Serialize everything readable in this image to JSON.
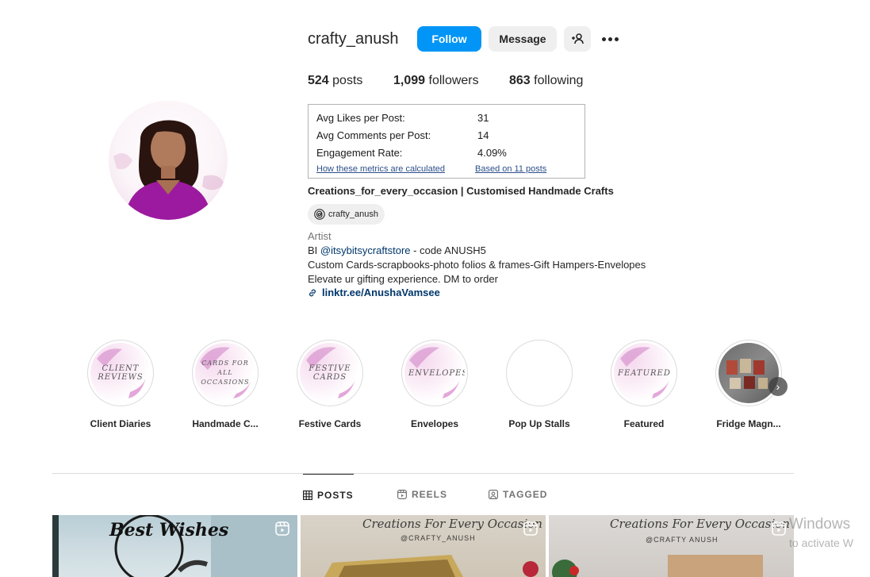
{
  "profile": {
    "username": "crafty_anush",
    "follow_label": "Follow",
    "message_label": "Message",
    "stats": {
      "posts_count": "524",
      "posts_label": "posts",
      "followers_count": "1,099",
      "followers_label": "followers",
      "following_count": "863",
      "following_label": "following"
    }
  },
  "metrics": {
    "avg_likes_label": "Avg Likes per Post:",
    "avg_likes_value": "31",
    "avg_comments_label": "Avg Comments per Post:",
    "avg_comments_value": "14",
    "engagement_label": "Engagement Rate:",
    "engagement_value": "4.09%",
    "how_link": "How these metrics are calculated",
    "based_link": "Based on 11 posts"
  },
  "bio": {
    "full_name": "Creations_for_every_occasion | Customised Handmade Crafts",
    "threads_handle": "crafty_anush",
    "category": "Artist",
    "line1_prefix": "BI ",
    "line1_mention": "@itsybitsycraftstore",
    "line1_suffix": " - code ANUSH5",
    "line2": "Custom Cards-scrapbooks-photo folios & frames-Gift Hampers-Envelopes",
    "line3": "Elevate ur gifting experience. DM to order",
    "link": "linktr.ee/AnushaVamsee"
  },
  "highlights": [
    {
      "label": "Client Diaries",
      "cover_text": "Client Reviews"
    },
    {
      "label": "Handmade C...",
      "cover_text": "Cards for all occasions"
    },
    {
      "label": "Festive Cards",
      "cover_text": "Festive Cards"
    },
    {
      "label": "Envelopes",
      "cover_text": "Envelopes"
    },
    {
      "label": "Pop Up Stalls",
      "cover_text": ""
    },
    {
      "label": "Featured",
      "cover_text": "Featured"
    },
    {
      "label": "Fridge Magn...",
      "cover_text": ""
    }
  ],
  "tabs": [
    {
      "label": "POSTS",
      "icon": "grid-icon"
    },
    {
      "label": "REELS",
      "icon": "reels-icon"
    },
    {
      "label": "TAGGED",
      "icon": "tagged-icon"
    }
  ],
  "posts": {
    "p1_text": "Best Wishes",
    "caption": "Creations For Every Occasion",
    "handle": "@CRAFTY_ANUSH",
    "handle_spaced": "@CRAFTY ANUSH"
  },
  "watermark": {
    "line1": "Windows",
    "line2": "to activate W"
  },
  "colors": {
    "follow_button": "#0095f6",
    "secondary_button": "#efefef",
    "link": "#00376b",
    "highlight_accent": "#c24fb0"
  }
}
